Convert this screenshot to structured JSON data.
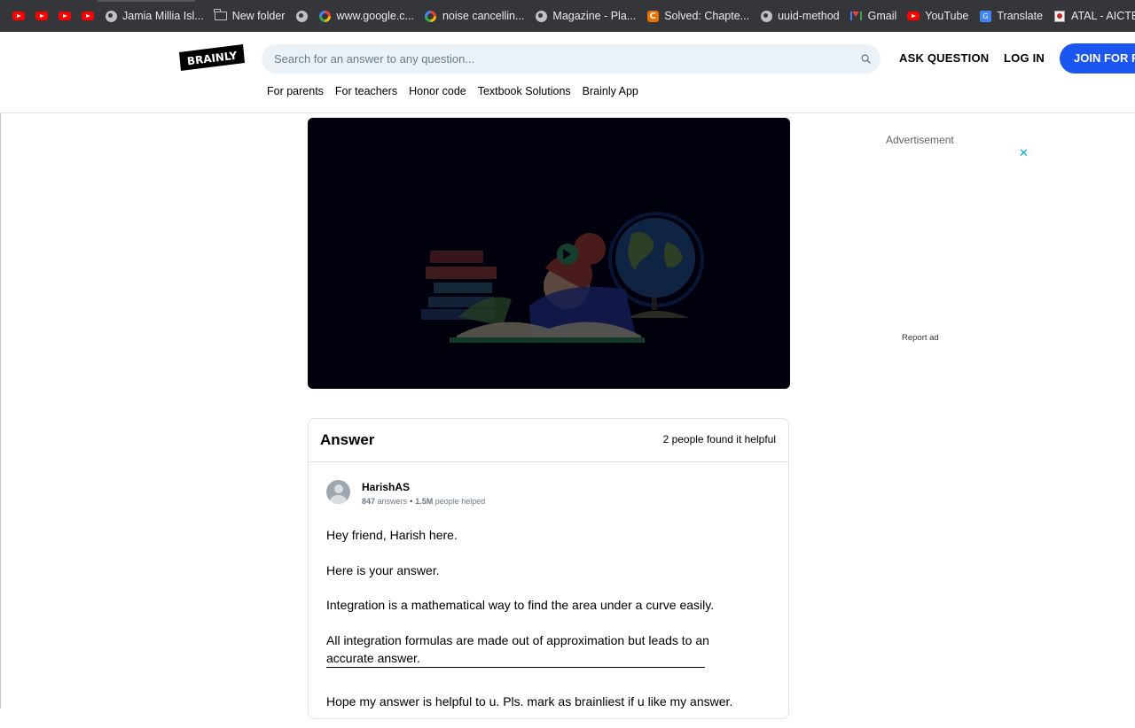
{
  "bookmarks": {
    "items": [
      {
        "label": "",
        "icon": "youtube-icon"
      },
      {
        "label": "",
        "icon": "youtube-icon"
      },
      {
        "label": "",
        "icon": "youtube-icon"
      },
      {
        "label": "",
        "icon": "youtube-icon"
      },
      {
        "label": "Jamia Millia Isl...",
        "icon": "globe-icon"
      },
      {
        "label": "New folder",
        "icon": "folder-icon"
      },
      {
        "label": "",
        "icon": "globe-icon"
      },
      {
        "label": "www.google.c...",
        "icon": "google-icon"
      },
      {
        "label": "noise cancellin...",
        "icon": "google-icon"
      },
      {
        "label": "Magazine - Pla...",
        "icon": "globe-icon"
      },
      {
        "label": "Solved: Chapte...",
        "icon": "chegg-icon"
      },
      {
        "label": "uuid-method",
        "icon": "globe-icon"
      },
      {
        "label": "Gmail",
        "icon": "gmail-icon"
      },
      {
        "label": "YouTube",
        "icon": "youtube-icon"
      },
      {
        "label": "Translate",
        "icon": "translate-icon"
      },
      {
        "label": "ATAL - AICTE",
        "icon": "atal-icon"
      }
    ]
  },
  "header": {
    "logo_text": "BRAINLY",
    "search_placeholder": "Search for an answer to any question...",
    "ask_label": "ASK QUESTION",
    "login_label": "LOG IN",
    "join_label": "JOIN FOR FREE",
    "nav": [
      "For parents",
      "For teachers",
      "Honor code",
      "Textbook Solutions",
      "Brainly App"
    ]
  },
  "ad": {
    "label": "Advertisement",
    "close": "✕",
    "report": "Report ad"
  },
  "answer": {
    "title": "Answer",
    "helpful_text": "2 people found it helpful",
    "user": {
      "name": "HarishAS",
      "answers_count": "847",
      "answers_label": "answers",
      "helped_count": "1.5M",
      "helped_label": "people helped"
    },
    "paragraphs": [
      "Hey friend, Harish here.",
      "Here is your answer.",
      "Integration is a mathematical way to find the area under a curve easily.",
      "All integration formulas are made out of approximation but leads to an accurate answer.",
      "Hope my answer is helpful to u. Pls. mark as brainliest if u like my answer."
    ]
  },
  "colors": {
    "brand_blue": "#1b56f0",
    "bookmark_bar": "#35363a",
    "video_bg": "#02020f"
  }
}
